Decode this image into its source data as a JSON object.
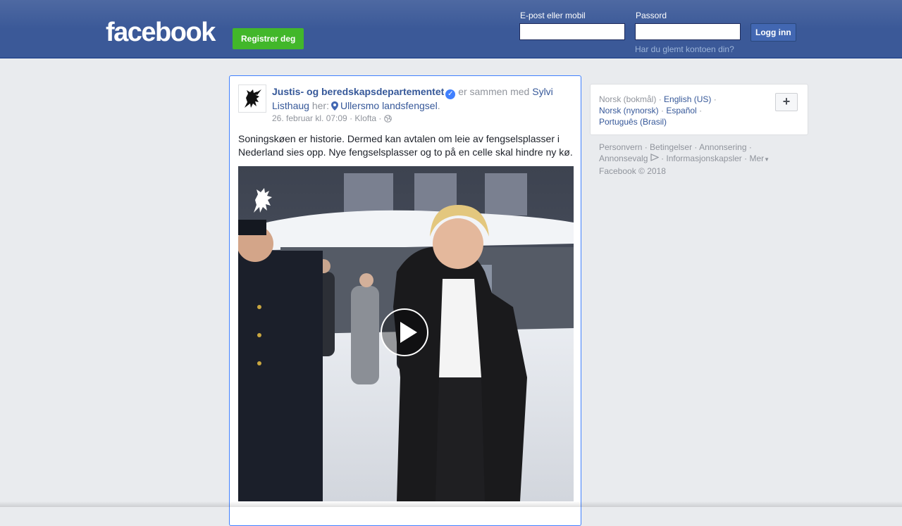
{
  "topbar": {
    "logo": "facebook",
    "register_label": "Registrer deg",
    "email_label": "E-post eller mobil",
    "email_value": "",
    "password_label": "Passord",
    "password_value": "",
    "login_label": "Logg inn",
    "forgot_label": "Har du glemt kontoen din?"
  },
  "post": {
    "author": "Justis- og beredskapsdepartementet",
    "with_text": "er sammen med",
    "with_person": "Sylvi Listhaug",
    "at_text": "her:",
    "location": "Ullersmo landsfengsel",
    "date": "26. februar kl. 07:09",
    "place": "Klofta",
    "privacy_icon": "globe-icon",
    "text": "Soningskøen er historie. Dermed kan avtalen om leie av fengselsplasser i Nederland sies opp. Nye fengselsplasser og to på en celle skal hindre ny kø.",
    "video_play_icon": "play-icon"
  },
  "languages": {
    "current": "Norsk (bokmål)",
    "items": [
      "English (US)",
      "Norsk (nynorsk)",
      "Español",
      "Português (Brasil)"
    ],
    "more_label": "+"
  },
  "footer": {
    "links": [
      "Personvern",
      "Betingelser",
      "Annonsering",
      "Annonsevalg",
      "Informasjonskapsler",
      "Mer"
    ],
    "copyright": "Facebook © 2018"
  },
  "colors": {
    "brand_blue": "#3b5998",
    "register_green": "#42b72a",
    "link_blue": "#365899",
    "verified_blue": "#4080ff"
  }
}
